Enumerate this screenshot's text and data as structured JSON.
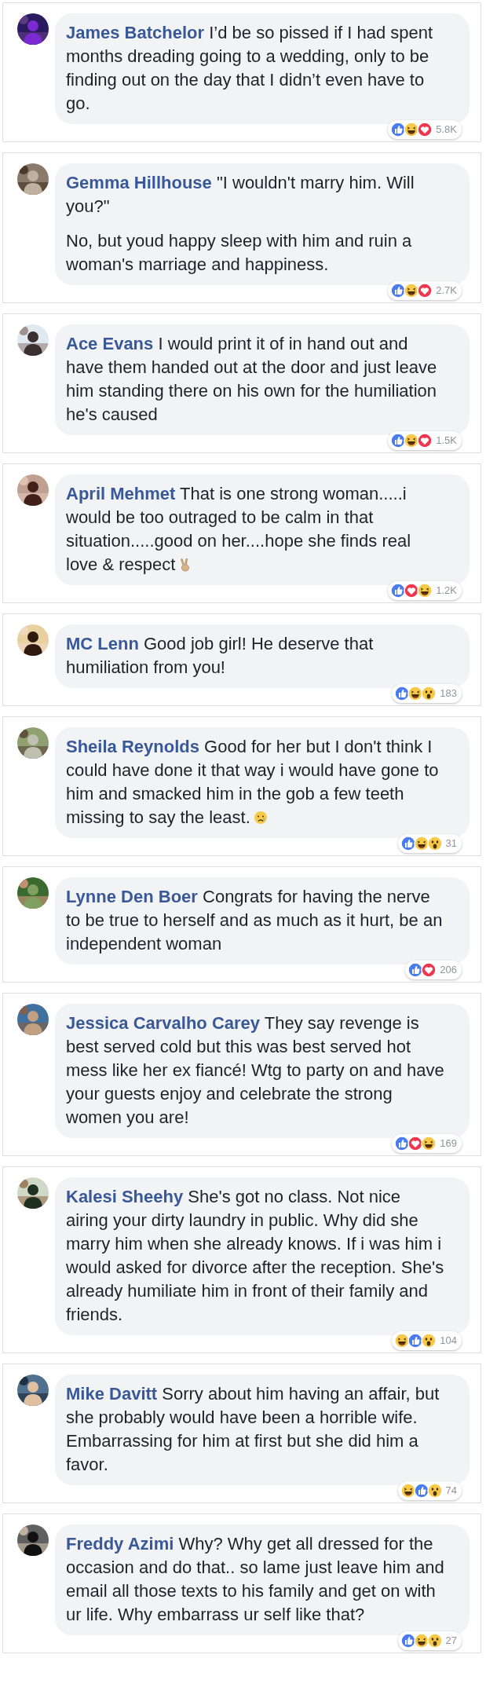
{
  "comments": [
    {
      "author": "James Batchelor",
      "paragraphs": [
        "I’d be so pissed if I had spent months dreading going to a wedding, only to be finding out on the day that I didn’t even have to go."
      ],
      "reactions": [
        {
          "kind": "like"
        },
        {
          "kind": "haha"
        },
        {
          "kind": "love"
        }
      ],
      "count": "5.8K"
    },
    {
      "author": "Gemma Hillhouse",
      "paragraphs": [
        "\"I wouldn't marry him. Will you?\"",
        "No, but youd happy sleep with him and ruin a woman's marriage and happiness."
      ],
      "reactions": [
        {
          "kind": "like"
        },
        {
          "kind": "haha"
        },
        {
          "kind": "love"
        }
      ],
      "count": "2.7K"
    },
    {
      "author": "Ace Evans",
      "paragraphs": [
        "I would print it of in hand out and have them handed out at the door and just leave him standing there on his own for the humiliation he's caused"
      ],
      "reactions": [
        {
          "kind": "like"
        },
        {
          "kind": "haha"
        },
        {
          "kind": "love"
        }
      ],
      "count": "1.5K"
    },
    {
      "author": "April Mehmet",
      "paragraphs": [
        "That is one strong woman.....i would be too outraged to be calm in that situation.....good on her....hope she finds real love & respect"
      ],
      "emoji": {
        "kind": "peace"
      },
      "reactions": [
        {
          "kind": "like"
        },
        {
          "kind": "love"
        },
        {
          "kind": "haha"
        }
      ],
      "count": "1.2K"
    },
    {
      "author": "MC Lenn",
      "paragraphs": [
        "Good job girl! He deserve that humiliation from you!"
      ],
      "reactions": [
        {
          "kind": "like"
        },
        {
          "kind": "haha"
        },
        {
          "kind": "wow"
        }
      ],
      "count": "183"
    },
    {
      "author": "Sheila Reynolds",
      "paragraphs": [
        "Good for her but I don't think I could have done it that way i would have gone to him and smacked him in the gob a few teeth missing to say the least."
      ],
      "emoji": {
        "kind": "sad"
      },
      "reactions": [
        {
          "kind": "like"
        },
        {
          "kind": "haha"
        },
        {
          "kind": "wow"
        }
      ],
      "count": "31"
    },
    {
      "author": "Lynne Den Boer",
      "paragraphs": [
        "Congrats for having the nerve to be true to herself and as much as it hurt, be an independent woman"
      ],
      "reactions": [
        {
          "kind": "like"
        },
        {
          "kind": "love"
        }
      ],
      "count": "206"
    },
    {
      "author": "Jessica Carvalho Carey",
      "paragraphs": [
        "They say revenge is best served cold but this was best served hot mess like her ex fiancé! Wtg to party on and have your guests enjoy and celebrate the strong women you are!"
      ],
      "reactions": [
        {
          "kind": "like"
        },
        {
          "kind": "love"
        },
        {
          "kind": "haha"
        }
      ],
      "count": "169"
    },
    {
      "author": "Kalesi Sheehy",
      "paragraphs": [
        "She's got no class. Not nice airing your dirty laundry in public. Why did she marry him when she already knows. If i was him i would asked for divorce after the reception. She's already humiliate him in front of their family and friends."
      ],
      "reactions": [
        {
          "kind": "haha"
        },
        {
          "kind": "like"
        },
        {
          "kind": "wow"
        }
      ],
      "count": "104"
    },
    {
      "author": "Mike Davitt",
      "paragraphs": [
        "Sorry about him having an affair, but she probably would have been a horrible wife. Embarrassing for him at first but she did him a favor."
      ],
      "reactions": [
        {
          "kind": "haha"
        },
        {
          "kind": "like"
        },
        {
          "kind": "wow"
        }
      ],
      "count": "74"
    },
    {
      "author": "Freddy Azimi",
      "paragraphs": [
        "Why? Why get all dressed for the occasion and do that.. so lame just leave him and email all those texts to his family and get on with ur life. Why embarrass ur self like that?"
      ],
      "reactions": [
        {
          "kind": "like"
        },
        {
          "kind": "haha"
        },
        {
          "kind": "wow"
        }
      ],
      "count": "27"
    }
  ]
}
